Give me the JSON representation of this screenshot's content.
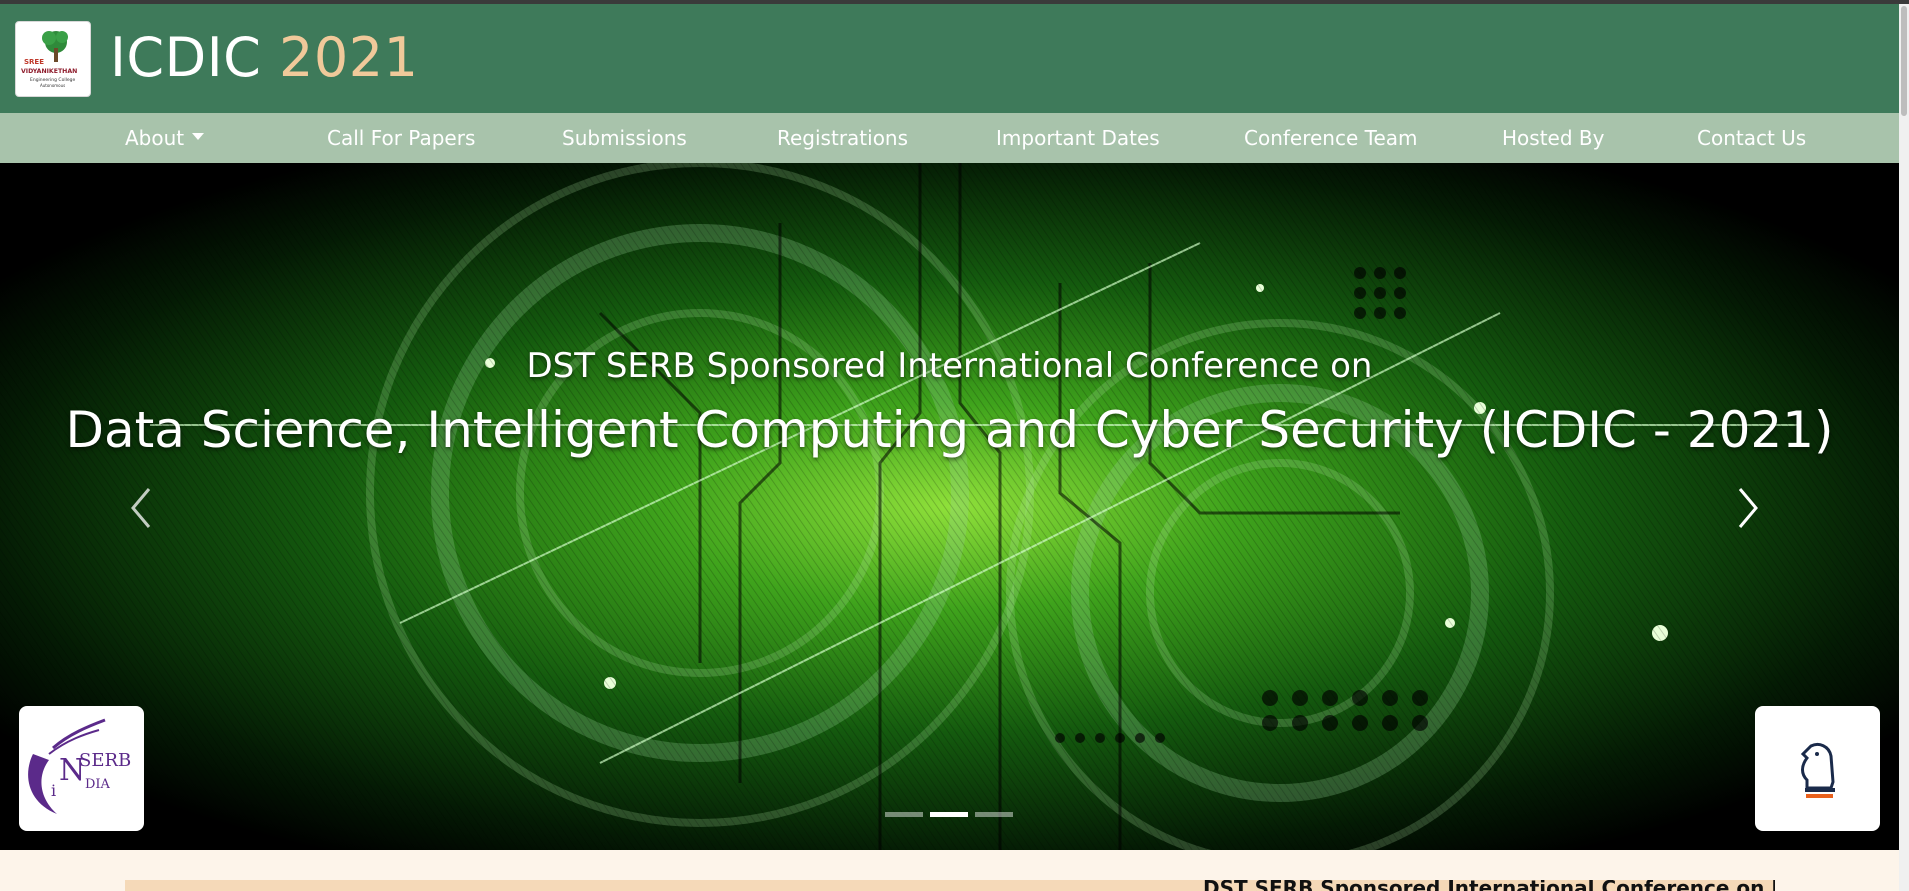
{
  "header": {
    "title_main": "ICDIC",
    "title_year": "2021",
    "logo": {
      "line1": "SREE",
      "line2": "VIDYANIKETHAN",
      "line3": "Engineering College",
      "line4": "Autonomous"
    }
  },
  "nav": {
    "items": [
      {
        "label": "About",
        "dropdown": true
      },
      {
        "label": "Call For Papers"
      },
      {
        "label": "Submissions"
      },
      {
        "label": "Registrations"
      },
      {
        "label": "Important Dates"
      },
      {
        "label": "Conference Team"
      },
      {
        "label": "Hosted By"
      },
      {
        "label": "Contact Us"
      }
    ]
  },
  "carousel": {
    "subtitle": "DST SERB Sponsored International Conference on",
    "title": "Data Science, Intelligent Computing and Cyber Security (ICDIC - 2021)",
    "prev_icon": "chevron-left-icon",
    "next_icon": "chevron-right-icon",
    "slide_count": 3,
    "active_slide": 2
  },
  "logos": {
    "serb": {
      "text1": "SERB",
      "text2": "DIA",
      "letter_i": "i",
      "letter_n": "N"
    },
    "right_logo_icon": "chess-knight-icon"
  },
  "marquee": {
    "text": "DST SERB Sponsored International Conference on Data Sci"
  },
  "colors": {
    "header_bg": "#3e7a5a",
    "nav_bg": "#a8c3ab",
    "year_accent": "#f0c99a",
    "page_bg": "#fdf4ea",
    "marquee_bg": "#f5d9b8"
  }
}
